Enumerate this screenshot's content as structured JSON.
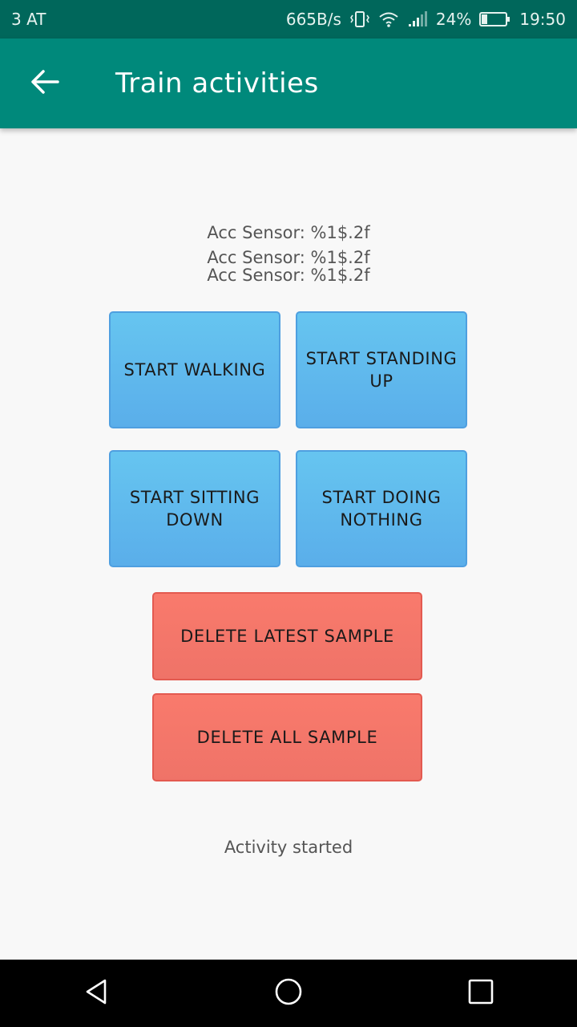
{
  "status_bar": {
    "carrier": "3 AT",
    "network_speed": "665B/s",
    "battery_percent": "24%",
    "time": "19:50",
    "battery_level": 0.24
  },
  "app_bar": {
    "title": "Train activities",
    "back_icon": "arrow-back-icon"
  },
  "sensors": [
    "Acc Sensor: %1$.2f",
    "Acc Sensor: %1$.2f",
    "Acc Sensor: %1$.2f"
  ],
  "buttons": {
    "start_walking": "START WALKING",
    "start_standing_up": "START STANDING UP",
    "start_sitting_down": "START SITTING DOWN",
    "start_doing_nothing": "START DOING NOTHING",
    "delete_latest_sample": "DELETE LATEST SAMPLE",
    "delete_all_sample": "DELETE ALL SAMPLE"
  },
  "status_message": "Activity started",
  "colors": {
    "status_bar": "#00675b",
    "app_bar": "#00897b",
    "blue_button": "#5fb8ee",
    "red_button": "#f47a6d"
  },
  "nav_bar": {
    "icons": [
      "back-triangle-icon",
      "home-circle-icon",
      "recents-square-icon"
    ]
  }
}
